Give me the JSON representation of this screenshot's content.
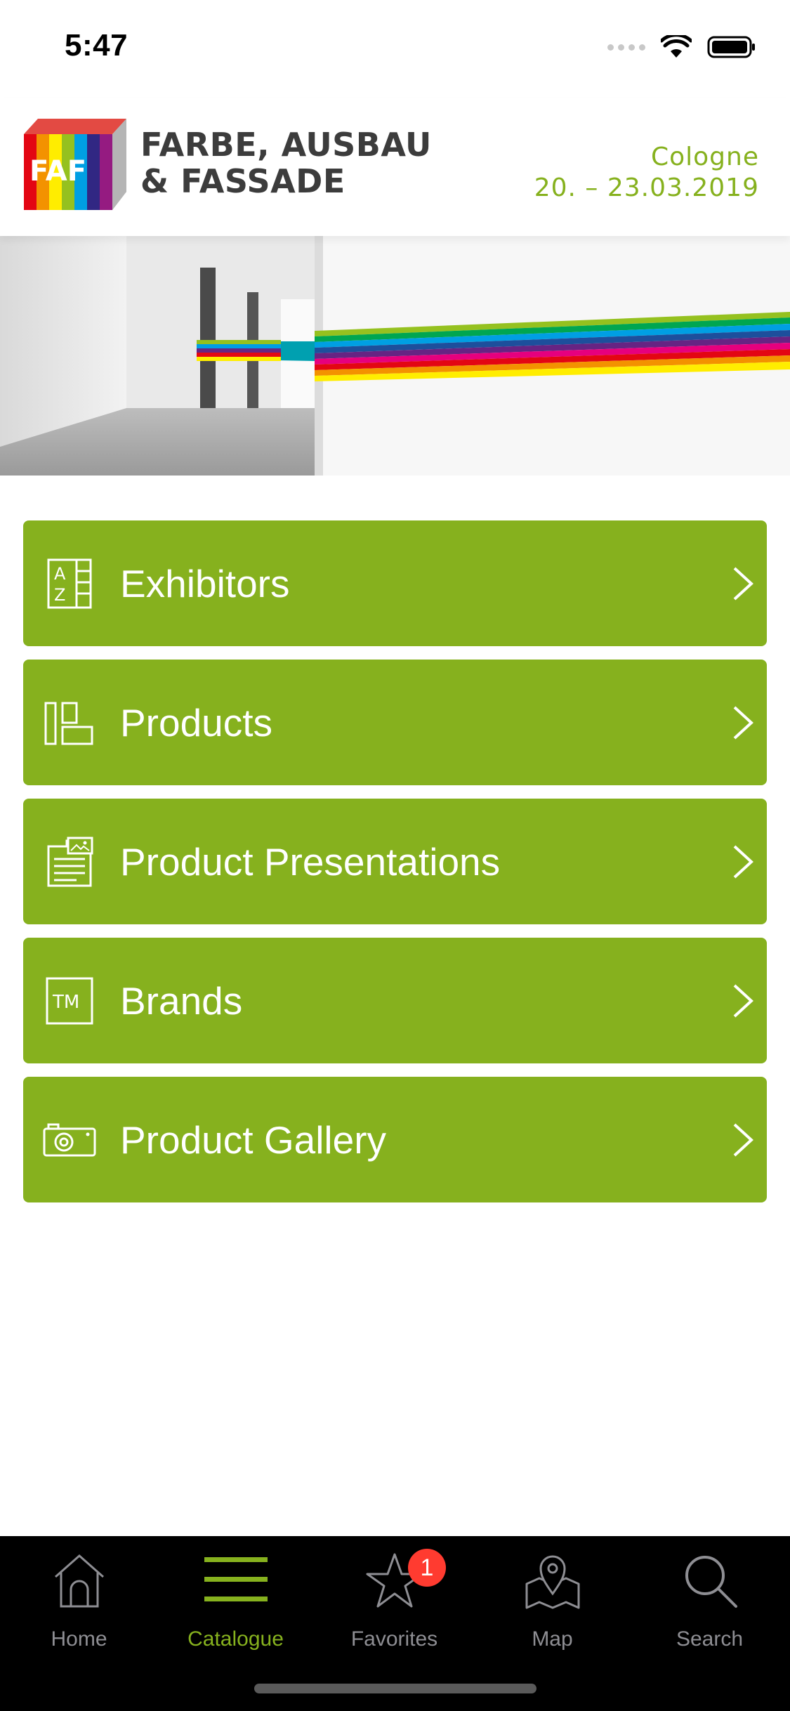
{
  "status_bar": {
    "time": "5:47"
  },
  "header": {
    "logo_text": "FAF",
    "title_line1": "FARBE, AUSBAU",
    "title_line2": "& FASSADE",
    "city": "Cologne",
    "dates": "20. – 23.03.2019"
  },
  "menu": {
    "items": [
      {
        "label": "Exhibitors",
        "icon": "az-list-icon"
      },
      {
        "label": "Products",
        "icon": "products-icon"
      },
      {
        "label": "Product Presentations",
        "icon": "presentation-icon"
      },
      {
        "label": "Brands",
        "icon": "trademark-icon"
      },
      {
        "label": "Product Gallery",
        "icon": "camera-icon"
      }
    ]
  },
  "tab_bar": {
    "tabs": [
      {
        "label": "Home",
        "icon": "home-icon",
        "active": false
      },
      {
        "label": "Catalogue",
        "icon": "menu-lines-icon",
        "active": true
      },
      {
        "label": "Favorites",
        "icon": "star-icon",
        "active": false,
        "badge": "1"
      },
      {
        "label": "Map",
        "icon": "map-icon",
        "active": false
      },
      {
        "label": "Search",
        "icon": "search-icon",
        "active": false
      }
    ]
  },
  "colors": {
    "accent": "#86b11e",
    "tab_bar_bg": "#000000",
    "badge": "#ff3b30"
  }
}
